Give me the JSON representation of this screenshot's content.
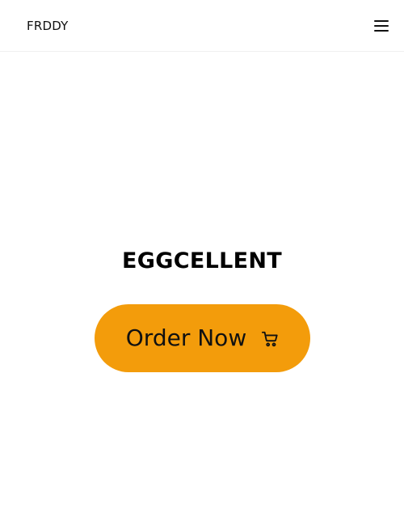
{
  "header": {
    "brand": "FRDDY",
    "menu_icon": "hamburger-menu-icon"
  },
  "hero": {
    "title": "EGGCELLENT",
    "order_button": {
      "label": "Order Now",
      "icon": "shopping-cart-icon"
    }
  },
  "colors": {
    "background": "#ffffff",
    "accent": "#f39c0b",
    "text": "#000000"
  }
}
